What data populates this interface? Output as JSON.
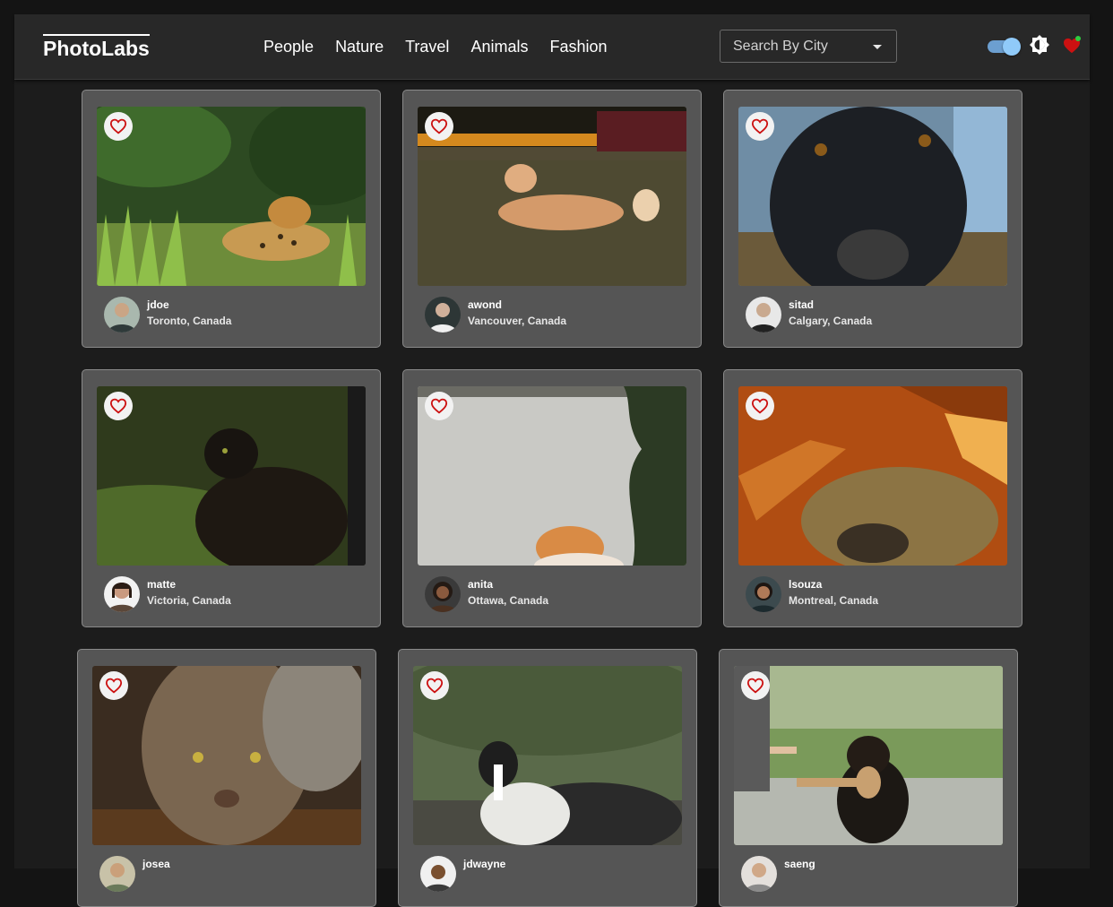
{
  "app": {
    "logo": "PhotoLabs",
    "topics": [
      "People",
      "Nature",
      "Travel",
      "Animals",
      "Fashion"
    ],
    "city_select": {
      "placeholder": "Search By City"
    },
    "theme_toggle": {
      "on": true
    },
    "icons": {
      "toggle": "toggle-switch",
      "theme": "brightness-icon",
      "favorites": "heart-icon",
      "notification": "notification-dot-icon"
    }
  },
  "photos": [
    {
      "username": "jdoe",
      "location": "Toronto, Canada",
      "subject": "jaguar in grass"
    },
    {
      "username": "awond",
      "location": "Vancouver, Canada",
      "subject": "dog lying on lawn"
    },
    {
      "username": "sitad",
      "location": "Calgary, Canada",
      "subject": "black dog close-up"
    },
    {
      "username": "matte",
      "location": "Victoria, Canada",
      "subject": "dark cat"
    },
    {
      "username": "anita",
      "location": "Ottawa, Canada",
      "subject": "orange cat by wall"
    },
    {
      "username": "lsouza",
      "location": "Montreal, Canada",
      "subject": "cat on rug in sunlight"
    },
    {
      "username": "josea",
      "location": "",
      "subject": "tabby cat drinking"
    },
    {
      "username": "jdwayne",
      "location": "",
      "subject": "border collie"
    },
    {
      "username": "saeng",
      "location": "",
      "subject": "dog giving paw"
    }
  ],
  "colors": {
    "heart": "#cc1111",
    "accent": "#90caf9",
    "notification": "#2ecc40"
  }
}
